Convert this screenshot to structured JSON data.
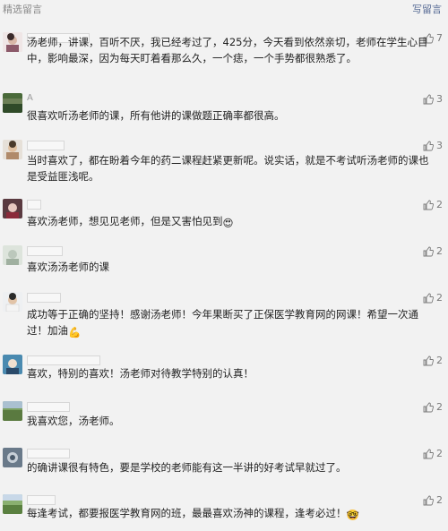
{
  "header": {
    "title": "精选留言",
    "write_label": "写留言"
  },
  "comments": [
    {
      "name": "",
      "text": "汤老师，讲课，百听不厌，我已经考过了，425分，今天看到依然亲切，老师在学生心目中，影响最深，因为每天盯着看那么久，一个痣，一个手势都很熟悉了。",
      "likes": "7"
    },
    {
      "name": "A",
      "text": "很喜欢听汤老师的课，所有他讲的课做题正确率都很高。",
      "likes": "3"
    },
    {
      "name": "",
      "text": "当时喜欢了，都在盼着今年的药二课程赶紧更新呢。说实话，就是不考试听汤老师的课也是受益匪浅呢。",
      "likes": "3"
    },
    {
      "name": "",
      "text": "喜欢汤老师，想见见老师，但是又害怕见到",
      "likes": "2",
      "emoji": "😍"
    },
    {
      "name": "",
      "text": "喜欢汤汤老师的课",
      "likes": "2"
    },
    {
      "name": "",
      "text": "成功等于正确的坚持！感谢汤老师！今年果断买了正保医学教育网的网课！希望一次通过！加油",
      "likes": "2",
      "emoji": "💪"
    },
    {
      "name": "",
      "text": "喜欢，特别的喜欢！汤老师对待教学特别的认真！",
      "likes": "2"
    },
    {
      "name": "",
      "text": "我喜欢您，汤老师。",
      "likes": "2"
    },
    {
      "name": "",
      "text": "的确讲课很有特色，要是学校的老师能有这一半讲的好考试早就过了。",
      "likes": "2"
    },
    {
      "name": "",
      "text": "每逢考试，都要报医学教育网的班，最最喜欢汤神的课程，逢考必过！",
      "likes": "2",
      "emoji": "🤓"
    }
  ],
  "colors": {
    "background": "#f2f2f2",
    "link": "#576b95",
    "muted": "#8a8a8a"
  },
  "icons": {
    "like": "thumb-up-icon"
  }
}
